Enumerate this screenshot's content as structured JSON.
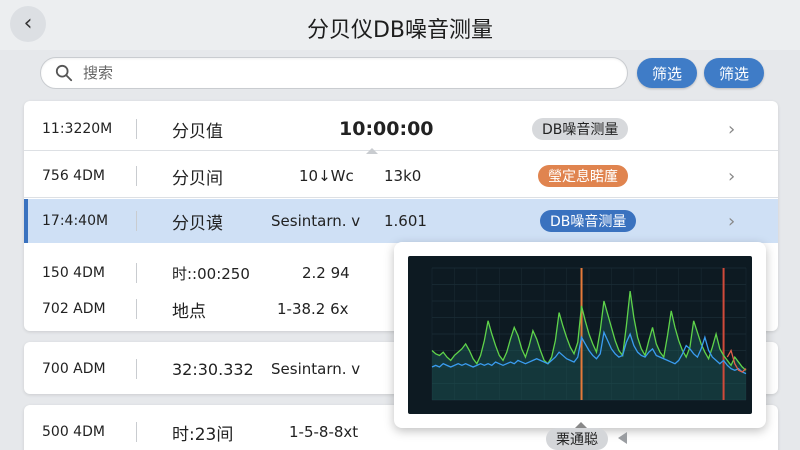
{
  "header": {
    "title": "分贝仪DB噪音测量",
    "back_icon": "chevron-left-icon"
  },
  "search": {
    "placeholder": "搜索"
  },
  "filters": [
    "筛选",
    "筛选"
  ],
  "colors": {
    "accent": "#3f7cc7",
    "selected_row": "#cfe0f5",
    "orange_tag": "#e0844f",
    "chart_bg": "#0d1a22"
  },
  "card1": {
    "rows": [
      {
        "time": "11:3220M",
        "label": "分贝值",
        "big": "10:00:00",
        "tag": "DB噪音测量",
        "tag_style": "gray"
      },
      {
        "time": "756 4DM",
        "label": "分贝间",
        "v1": "10↓Wc",
        "v2": "13k0",
        "tag": "瑩定息睰廑",
        "tag_style": "orange"
      },
      {
        "time": "17:4:40M",
        "label": "分贝谟",
        "v1": "Sesintarn. v",
        "v2": "1.601",
        "tag": "DB噪音测量",
        "tag_style": "blue"
      },
      {
        "time": "150 4DM",
        "label": "时::00:250",
        "v1": "2.2 94"
      },
      {
        "time": "702 ADM",
        "label": "地点",
        "v1": "1-38.2 6x"
      }
    ]
  },
  "card2": {
    "rows": [
      {
        "time": "700 ADM",
        "label": "32:30.332",
        "v1": "Sesintarn. v"
      }
    ]
  },
  "card3": {
    "rows": [
      {
        "time": "500 4DM",
        "label": "时:23间",
        "v1": "1-5-8-8xt"
      }
    ]
  },
  "popup": {
    "chart_data": {
      "type": "line",
      "title": "",
      "series": [
        {
          "color": "#5fd34a",
          "values": [
            30,
            28,
            27,
            29,
            26,
            24,
            27,
            29,
            31,
            34,
            30,
            25,
            22,
            27,
            36,
            48,
            40,
            33,
            27,
            24,
            29,
            37,
            44,
            39,
            31,
            26,
            33,
            42,
            37,
            30,
            24,
            22,
            26,
            36,
            53,
            45,
            38,
            32,
            28,
            35,
            57,
            48,
            40,
            34,
            29,
            42,
            60,
            52,
            44,
            36,
            30,
            27,
            45,
            66,
            50,
            38,
            31,
            27,
            36,
            44,
            34,
            29,
            26,
            39,
            54,
            44,
            36,
            30,
            26,
            32,
            48,
            41,
            34,
            29,
            25,
            32,
            40,
            31,
            27,
            24,
            21,
            26,
            23,
            20,
            18
          ]
        },
        {
          "color": "#3a9cf0",
          "values": [
            20,
            21,
            20,
            22,
            21,
            20,
            21,
            22,
            21,
            22,
            21,
            20,
            21,
            22,
            21,
            22,
            21,
            23,
            22,
            21,
            22,
            23,
            22,
            24,
            23,
            22,
            23,
            24,
            25,
            24,
            23,
            22,
            24,
            26,
            29,
            27,
            25,
            24,
            23,
            26,
            38,
            34,
            30,
            27,
            25,
            28,
            41,
            36,
            31,
            28,
            26,
            27,
            35,
            40,
            33,
            29,
            27,
            26,
            29,
            31,
            27,
            26,
            25,
            24,
            23,
            22,
            24,
            28,
            33,
            31,
            28,
            26,
            31,
            38,
            30,
            26,
            24,
            22,
            24,
            21,
            19,
            18,
            19,
            17,
            16
          ]
        },
        {
          "color": "#e0604a",
          "values": [
            null,
            null,
            null,
            null,
            null,
            null,
            null,
            null,
            null,
            null,
            null,
            null,
            null,
            null,
            null,
            null,
            null,
            null,
            null,
            null,
            null,
            null,
            null,
            null,
            null,
            null,
            null,
            null,
            null,
            null,
            null,
            null,
            null,
            null,
            null,
            null,
            null,
            null,
            null,
            null,
            null,
            null,
            null,
            null,
            null,
            null,
            null,
            null,
            null,
            null,
            null,
            null,
            null,
            null,
            null,
            null,
            null,
            null,
            null,
            null,
            null,
            null,
            null,
            null,
            null,
            null,
            null,
            null,
            null,
            null,
            null,
            null,
            null,
            null,
            null,
            null,
            null,
            null,
            null,
            26,
            30,
            22,
            18,
            17,
            19
          ]
        }
      ],
      "markers": [
        {
          "index": 40,
          "color": "#e67a3a"
        },
        {
          "index": 78,
          "color": "#d04a3a"
        }
      ],
      "ylim": [
        0,
        80
      ]
    }
  },
  "bottom_tag": "栗通聪"
}
